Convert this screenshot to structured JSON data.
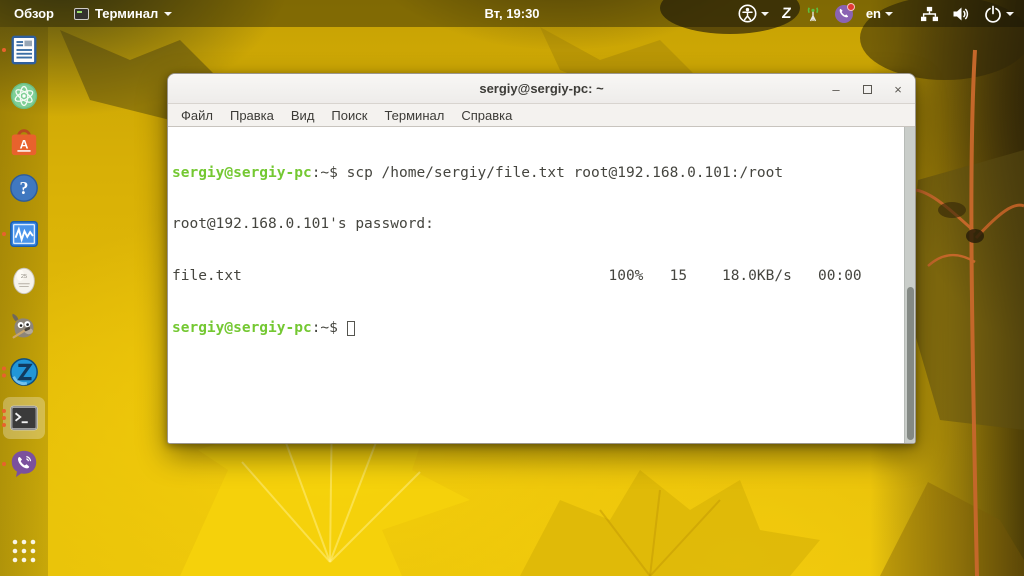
{
  "panel": {
    "activities": "Обзор",
    "app_menu_label": "Терминал",
    "clock": "Вт, 19:30",
    "language": "en",
    "tray_icons": [
      "accessibility",
      "zoiper",
      "network-signal",
      "viber",
      "keyboard-layout",
      "ethernet",
      "volume",
      "power"
    ]
  },
  "dock": {
    "items": [
      {
        "name": "document-viewer",
        "dots": 1
      },
      {
        "name": "atom-editor",
        "dots": 0
      },
      {
        "name": "ubuntu-software",
        "dots": 0
      },
      {
        "name": "help",
        "dots": 0
      },
      {
        "name": "system-monitor",
        "dots": 1
      },
      {
        "name": "egg-timer",
        "dots": 0
      },
      {
        "name": "gimp",
        "dots": 0
      },
      {
        "name": "zoiper",
        "dots": 2
      },
      {
        "name": "terminal",
        "dots": 3,
        "active": true
      },
      {
        "name": "viber",
        "dots": 1
      },
      {
        "name": "show-applications",
        "dots": 0
      }
    ]
  },
  "window": {
    "title": "sergiy@sergiy-pc: ~",
    "menu": [
      "Файл",
      "Правка",
      "Вид",
      "Поиск",
      "Терминал",
      "Справка"
    ],
    "controls": {
      "minimize": "–",
      "close": "×"
    }
  },
  "terminal": {
    "prompt_user": "sergiy@sergiy-pc",
    "prompt_tail": ":~$ ",
    "command": "scp /home/sergiy/file.txt root@192.168.0.101:/root",
    "password_line": "root@192.168.0.101's password:",
    "transfer_line": "file.txt                                          100%   15    18.0KB/s   00:00",
    "transfer": {
      "file": "file.txt",
      "percent": "100%",
      "size": "15",
      "speed": "18.0KB/s",
      "time": "00:00"
    }
  },
  "colors": {
    "prompt_green": "#74c832",
    "accent_orange": "#e8622d",
    "panel_bg": "rgba(14,13,5,0.38)",
    "wallpaper_yellow": "#e3bb08"
  }
}
